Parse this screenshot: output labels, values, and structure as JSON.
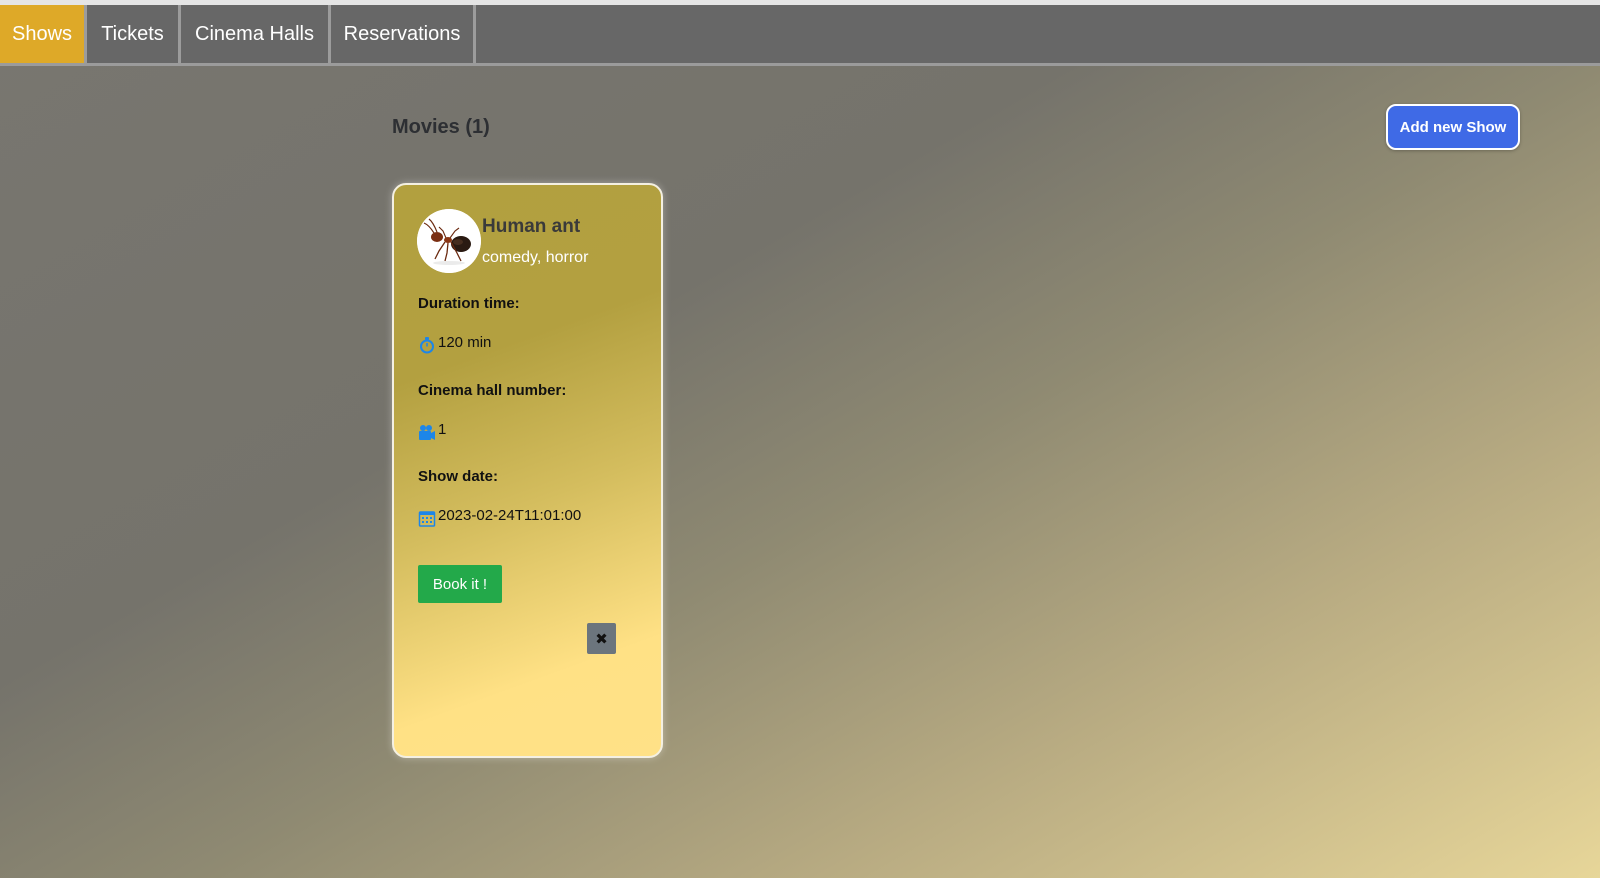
{
  "nav": {
    "tabs": [
      {
        "label": "Shows",
        "active": true
      },
      {
        "label": "Tickets",
        "active": false
      },
      {
        "label": "Cinema Halls",
        "active": false
      },
      {
        "label": "Reservations",
        "active": false
      }
    ]
  },
  "main": {
    "heading": "Movies (1)",
    "add_button_label": "Add new Show"
  },
  "movies": [
    {
      "title": "Human ant",
      "genres": "comedy, horror",
      "duration_label": "Duration time:",
      "duration_value": "120 min",
      "hall_label": "Cinema hall number:",
      "hall_value": "1",
      "date_label": "Show date:",
      "date_value": "2023-02-24T11:01:00",
      "book_label": "Book it !",
      "delete_label": "✖"
    }
  ],
  "colors": {
    "active_tab": "#dea928",
    "navbar": "#676767",
    "add_button": "#3f6ae6",
    "book_button": "#23a94a",
    "delete_button": "#6c757d",
    "icon_blue": "#1d86e8"
  },
  "icons": {
    "duration": "stopwatch-icon",
    "hall": "video-camera-icon",
    "date": "calendar-icon",
    "delete": "close-icon"
  }
}
